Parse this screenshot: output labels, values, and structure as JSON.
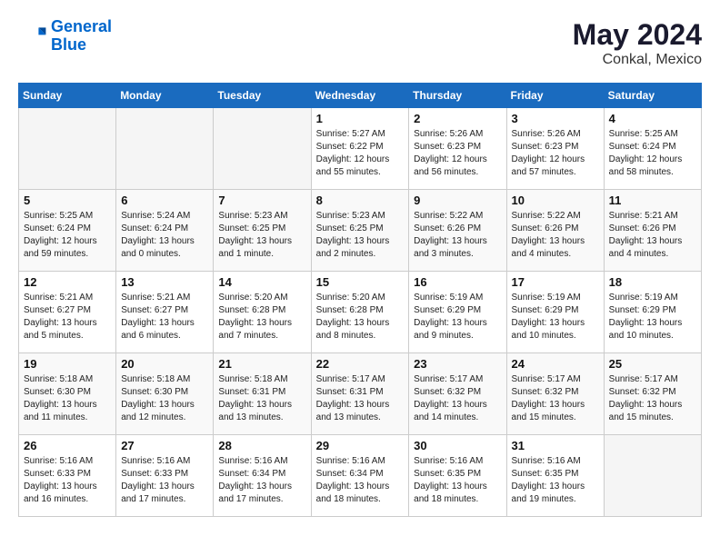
{
  "header": {
    "logo_line1": "General",
    "logo_line2": "Blue",
    "month_year": "May 2024",
    "location": "Conkal, Mexico"
  },
  "weekdays": [
    "Sunday",
    "Monday",
    "Tuesday",
    "Wednesday",
    "Thursday",
    "Friday",
    "Saturday"
  ],
  "weeks": [
    [
      {
        "day": "",
        "info": ""
      },
      {
        "day": "",
        "info": ""
      },
      {
        "day": "",
        "info": ""
      },
      {
        "day": "1",
        "info": "Sunrise: 5:27 AM\nSunset: 6:22 PM\nDaylight: 12 hours\nand 55 minutes."
      },
      {
        "day": "2",
        "info": "Sunrise: 5:26 AM\nSunset: 6:23 PM\nDaylight: 12 hours\nand 56 minutes."
      },
      {
        "day": "3",
        "info": "Sunrise: 5:26 AM\nSunset: 6:23 PM\nDaylight: 12 hours\nand 57 minutes."
      },
      {
        "day": "4",
        "info": "Sunrise: 5:25 AM\nSunset: 6:24 PM\nDaylight: 12 hours\nand 58 minutes."
      }
    ],
    [
      {
        "day": "5",
        "info": "Sunrise: 5:25 AM\nSunset: 6:24 PM\nDaylight: 12 hours\nand 59 minutes."
      },
      {
        "day": "6",
        "info": "Sunrise: 5:24 AM\nSunset: 6:24 PM\nDaylight: 13 hours\nand 0 minutes."
      },
      {
        "day": "7",
        "info": "Sunrise: 5:23 AM\nSunset: 6:25 PM\nDaylight: 13 hours\nand 1 minute."
      },
      {
        "day": "8",
        "info": "Sunrise: 5:23 AM\nSunset: 6:25 PM\nDaylight: 13 hours\nand 2 minutes."
      },
      {
        "day": "9",
        "info": "Sunrise: 5:22 AM\nSunset: 6:26 PM\nDaylight: 13 hours\nand 3 minutes."
      },
      {
        "day": "10",
        "info": "Sunrise: 5:22 AM\nSunset: 6:26 PM\nDaylight: 13 hours\nand 4 minutes."
      },
      {
        "day": "11",
        "info": "Sunrise: 5:21 AM\nSunset: 6:26 PM\nDaylight: 13 hours\nand 4 minutes."
      }
    ],
    [
      {
        "day": "12",
        "info": "Sunrise: 5:21 AM\nSunset: 6:27 PM\nDaylight: 13 hours\nand 5 minutes."
      },
      {
        "day": "13",
        "info": "Sunrise: 5:21 AM\nSunset: 6:27 PM\nDaylight: 13 hours\nand 6 minutes."
      },
      {
        "day": "14",
        "info": "Sunrise: 5:20 AM\nSunset: 6:28 PM\nDaylight: 13 hours\nand 7 minutes."
      },
      {
        "day": "15",
        "info": "Sunrise: 5:20 AM\nSunset: 6:28 PM\nDaylight: 13 hours\nand 8 minutes."
      },
      {
        "day": "16",
        "info": "Sunrise: 5:19 AM\nSunset: 6:29 PM\nDaylight: 13 hours\nand 9 minutes."
      },
      {
        "day": "17",
        "info": "Sunrise: 5:19 AM\nSunset: 6:29 PM\nDaylight: 13 hours\nand 10 minutes."
      },
      {
        "day": "18",
        "info": "Sunrise: 5:19 AM\nSunset: 6:29 PM\nDaylight: 13 hours\nand 10 minutes."
      }
    ],
    [
      {
        "day": "19",
        "info": "Sunrise: 5:18 AM\nSunset: 6:30 PM\nDaylight: 13 hours\nand 11 minutes."
      },
      {
        "day": "20",
        "info": "Sunrise: 5:18 AM\nSunset: 6:30 PM\nDaylight: 13 hours\nand 12 minutes."
      },
      {
        "day": "21",
        "info": "Sunrise: 5:18 AM\nSunset: 6:31 PM\nDaylight: 13 hours\nand 13 minutes."
      },
      {
        "day": "22",
        "info": "Sunrise: 5:17 AM\nSunset: 6:31 PM\nDaylight: 13 hours\nand 13 minutes."
      },
      {
        "day": "23",
        "info": "Sunrise: 5:17 AM\nSunset: 6:32 PM\nDaylight: 13 hours\nand 14 minutes."
      },
      {
        "day": "24",
        "info": "Sunrise: 5:17 AM\nSunset: 6:32 PM\nDaylight: 13 hours\nand 15 minutes."
      },
      {
        "day": "25",
        "info": "Sunrise: 5:17 AM\nSunset: 6:32 PM\nDaylight: 13 hours\nand 15 minutes."
      }
    ],
    [
      {
        "day": "26",
        "info": "Sunrise: 5:16 AM\nSunset: 6:33 PM\nDaylight: 13 hours\nand 16 minutes."
      },
      {
        "day": "27",
        "info": "Sunrise: 5:16 AM\nSunset: 6:33 PM\nDaylight: 13 hours\nand 17 minutes."
      },
      {
        "day": "28",
        "info": "Sunrise: 5:16 AM\nSunset: 6:34 PM\nDaylight: 13 hours\nand 17 minutes."
      },
      {
        "day": "29",
        "info": "Sunrise: 5:16 AM\nSunset: 6:34 PM\nDaylight: 13 hours\nand 18 minutes."
      },
      {
        "day": "30",
        "info": "Sunrise: 5:16 AM\nSunset: 6:35 PM\nDaylight: 13 hours\nand 18 minutes."
      },
      {
        "day": "31",
        "info": "Sunrise: 5:16 AM\nSunset: 6:35 PM\nDaylight: 13 hours\nand 19 minutes."
      },
      {
        "day": "",
        "info": ""
      }
    ]
  ]
}
